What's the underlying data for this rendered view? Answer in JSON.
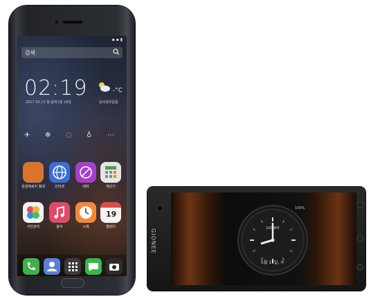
{
  "phone1": {
    "search_label": "검색",
    "clock_time": "02:19",
    "date_line": "2017.02.13 월 음력1월 18일",
    "temperature": "-°C",
    "city": "날씨정보없음",
    "quick_toggles": [
      "airplane-icon",
      "brightness-icon",
      "data-icon",
      "location-icon",
      "more-icon"
    ],
    "apps_row1": [
      {
        "label": "응원메세지 월대",
        "icon": "character-app-icon",
        "color": "#d9742f"
      },
      {
        "label": "인터넷",
        "icon": "globe-app-icon",
        "color": "#3a6ed8"
      },
      {
        "label": "테마",
        "icon": "theme-app-icon",
        "color": "#a640c8"
      },
      {
        "label": "계산기",
        "icon": "calculator-app-icon",
        "color": "#e5e5e5"
      }
    ],
    "apps_row2": [
      {
        "label": "사진관리",
        "icon": "gallery-app-icon",
        "color": "#f2f2f2"
      },
      {
        "label": "음악",
        "icon": "music-app-icon",
        "color": "#e04a6a"
      },
      {
        "label": "시계",
        "icon": "clock-app-icon",
        "color": "#f08a3a"
      },
      {
        "label": "캘린더",
        "icon": "calendar-app-icon",
        "color": "#f4f4f4",
        "day": "19"
      }
    ],
    "dock": [
      {
        "icon": "phone-app-icon",
        "color": "#3fb04a"
      },
      {
        "icon": "contacts-app-icon",
        "color": "#5a7fd8"
      },
      {
        "icon": "apps-grid-icon",
        "color": "#3a3a3a"
      },
      {
        "icon": "message-app-icon",
        "color": "#38b84a"
      },
      {
        "icon": "camera-app-icon",
        "color": "#2c2c2c"
      }
    ]
  },
  "phone2": {
    "brand": "GIONEE",
    "status": "100%",
    "date_line": "5월 11일, 수",
    "clock_logo": "GIONEE"
  }
}
